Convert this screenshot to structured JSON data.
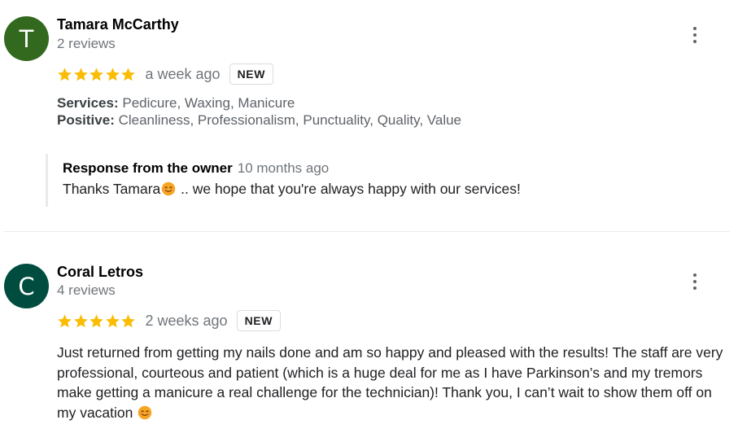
{
  "reviews": [
    {
      "avatar_letter": "T",
      "avatar_color": "#33691e",
      "name": "Tamara McCarthy",
      "review_count": "2 reviews",
      "stars": 5,
      "time": "a week ago",
      "badge": "NEW",
      "services_label": "Services:",
      "services_value": "Pedicure, Waxing, Manicure",
      "positive_label": "Positive:",
      "positive_value": "Cleanliness, Professionalism, Punctuality, Quality, Value",
      "owner_response": {
        "title": "Response from the owner",
        "time": "10 months ago",
        "text_before": "Thanks Tamara",
        "text_after": ".. we hope that you're always happy with our services!"
      }
    },
    {
      "avatar_letter": "C",
      "avatar_color": "#004d40",
      "name": "Coral Letros",
      "review_count": "4 reviews",
      "stars": 5,
      "time": "2 weeks ago",
      "badge": "NEW",
      "text": "Just returned from getting my nails done and am so happy and pleased with the results!  The staff are very professional, courteous and patient (which is a huge deal for me as I have Parkinson’s and my tremors make getting a manicure a real challenge for the technician)!  Thank you, I can’t wait to show them off on my vacation"
    }
  ],
  "colors": {
    "star": "#fbbc04",
    "emoji": "#f6a623"
  },
  "icons": [
    "more-vert-icon",
    "star-icon",
    "smiling-face-emoji-icon"
  ]
}
